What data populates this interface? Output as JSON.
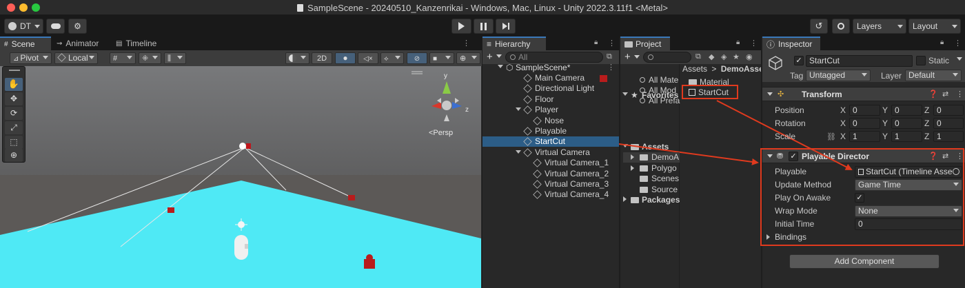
{
  "window": {
    "title": "SampleScene - 20240510_Kanzenrikai - Windows, Mac, Linux - Unity 2022.3.11f1 <Metal>"
  },
  "toolbar": {
    "account": "DT",
    "layers": "Layers",
    "layout": "Layout"
  },
  "scene_panel": {
    "tabs": [
      "Scene",
      "Animator",
      "Timeline"
    ],
    "pivot": "Pivot",
    "local": "Local",
    "mode_2d": "2D",
    "persp": "<Persp",
    "gizmo_y": "y",
    "gizmo_z": "z"
  },
  "hierarchy": {
    "tab": "Hierarchy",
    "search_placeholder": "All",
    "root": "SampleScene*",
    "items": [
      {
        "label": "Main Camera",
        "indent": 1
      },
      {
        "label": "Directional Light",
        "indent": 1
      },
      {
        "label": "Floor",
        "indent": 1
      },
      {
        "label": "Player",
        "indent": 1
      },
      {
        "label": "Nose",
        "indent": 2
      },
      {
        "label": "Playable",
        "indent": 1
      },
      {
        "label": "StartCut",
        "indent": 1,
        "selected": true
      },
      {
        "label": "Virtual Camera",
        "indent": 1
      },
      {
        "label": "Virtual Camera_1",
        "indent": 2
      },
      {
        "label": "Virtual Camera_2",
        "indent": 2
      },
      {
        "label": "Virtual Camera_3",
        "indent": 2
      },
      {
        "label": "Virtual Camera_4",
        "indent": 2
      }
    ]
  },
  "project": {
    "tab": "Project",
    "favorites_label": "Favorites",
    "favorites": [
      "All Mate",
      "All Mod",
      "All Prefa"
    ],
    "assets_label": "Assets",
    "assets": [
      "DemoA",
      "Polygo",
      "Scenes",
      "Source"
    ],
    "packages_label": "Packages",
    "breadcrumb_root": "Assets",
    "breadcrumb_sep": ">",
    "breadcrumb_current": "DemoAsse",
    "files": [
      "Material",
      "StartCut"
    ]
  },
  "inspector": {
    "tab": "Inspector",
    "object_name": "StartCut",
    "static_label": "Static",
    "tag_label": "Tag",
    "tag_value": "Untagged",
    "layer_label": "Layer",
    "layer_value": "Default",
    "transform": {
      "title": "Transform",
      "position_label": "Position",
      "rotation_label": "Rotation",
      "scale_label": "Scale",
      "axis_x": "X",
      "axis_y": "Y",
      "axis_z": "Z",
      "position": [
        "0",
        "0",
        "0"
      ],
      "rotation": [
        "0",
        "0",
        "0"
      ],
      "scale": [
        "1",
        "1",
        "1"
      ]
    },
    "playable_director": {
      "title": "Playable Director",
      "playable_label": "Playable",
      "playable_value": "StartCut (Timeline Asse",
      "update_method_label": "Update Method",
      "update_method_value": "Game Time",
      "play_on_awake_label": "Play On Awake",
      "wrap_mode_label": "Wrap Mode",
      "wrap_mode_value": "None",
      "initial_time_label": "Initial Time",
      "initial_time_value": "0",
      "bindings_label": "Bindings"
    },
    "add_component": "Add Component"
  },
  "colors": {
    "accent": "#2c5d87",
    "highlight": "#e03a1e",
    "floor": "#4fe8f4",
    "sky": "#6b6c6e",
    "ground": "#5f5c5a"
  }
}
